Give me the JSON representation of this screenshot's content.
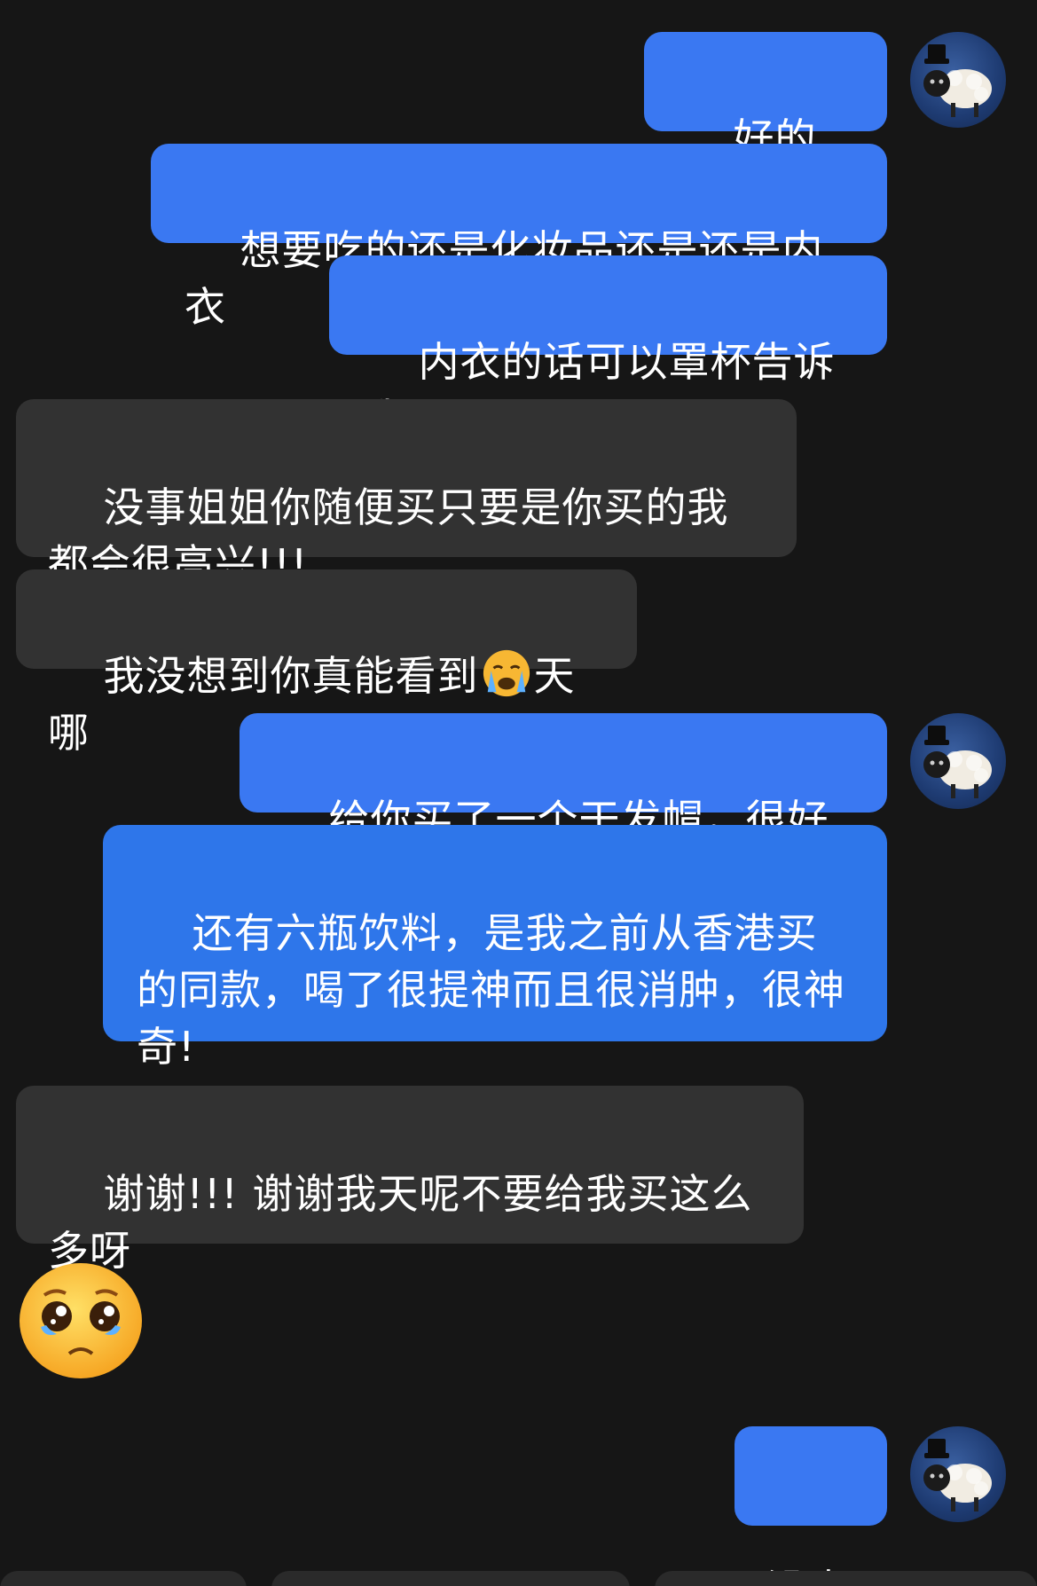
{
  "messages": {
    "m1": {
      "text": "好的宝贝"
    },
    "m2": {
      "text": "想要吃的还是化妆品还是还是内衣"
    },
    "m3": {
      "text": "内衣的话可以罩杯告诉我"
    },
    "m4": {
      "text": "没事姐姐你随便买只要是你买的我都会很高兴!!!"
    },
    "m5": {
      "before": "我没想到你真能看到",
      "after": "天哪",
      "emoji": "crying-face"
    },
    "m6": {
      "text": "给你买了一个干发帽，很好用"
    },
    "m7": {
      "text": "还有六瓶饮料，是我之前从香港买的同款，喝了很提神而且很消肿，很神奇!"
    },
    "m8": {
      "text": "谢谢!!! 谢谢我天呢不要给我买这么多呀"
    },
    "m9": {
      "emoji": "pleading-face-with-tears"
    },
    "m10": {
      "text": "没事"
    }
  },
  "colors": {
    "background": "#161616",
    "sent_bubble": "#3a78f2",
    "received_bubble": "#323232"
  },
  "icons": {
    "avatar": "pug-sheep-top-hat-avatar"
  }
}
